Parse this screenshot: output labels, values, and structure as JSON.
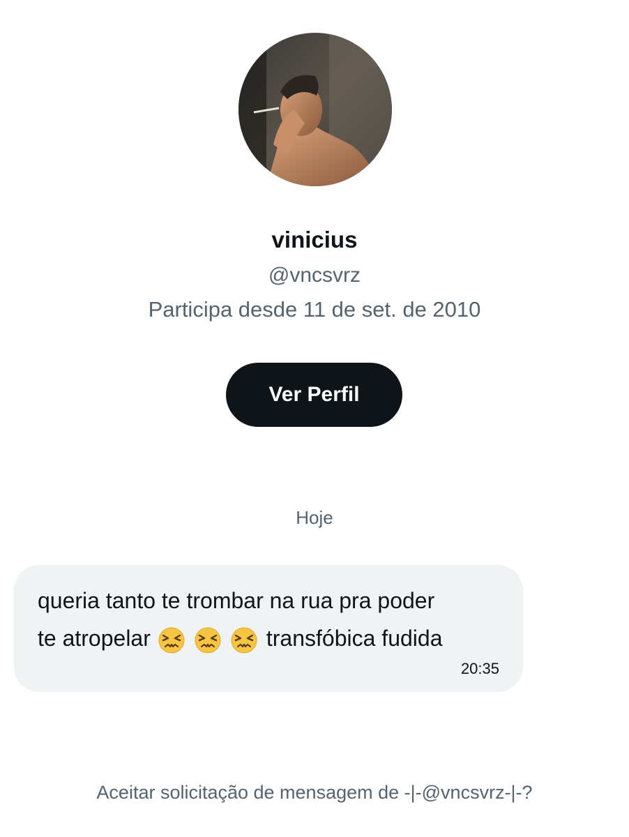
{
  "profile": {
    "display_name": "vinicius",
    "handle": "@vncsvrz",
    "joined": "Participa desde 11 de set. de 2010",
    "view_profile_label": "Ver Perfil"
  },
  "conversation": {
    "date_divider": "Hoje",
    "messages": [
      {
        "line1": "queria tanto te trombar na rua pra poder",
        "line2_before": "te atropelar",
        "emojis": [
          "confounded-face",
          "confounded-face",
          "confounded-face"
        ],
        "line2_after": "transfóbica fudida",
        "time": "20:35"
      }
    ]
  },
  "request": {
    "prompt": "Aceitar solicitação de mensagem de -|-@vncsvrz-|-?"
  },
  "colors": {
    "primary_text": "#0f1419",
    "secondary_text": "#536471",
    "bubble_bg": "#eff3f4",
    "button_bg": "#0f1419",
    "button_text": "#ffffff"
  }
}
